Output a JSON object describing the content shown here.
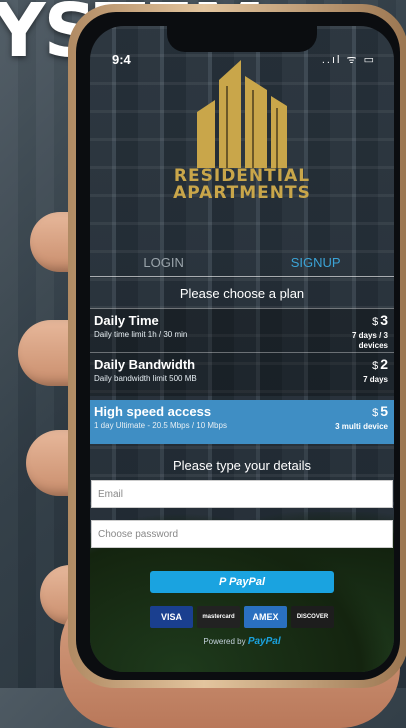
{
  "headline": "YSTEM",
  "status": {
    "time": "9:4",
    "icons": "..ıl ᯤ ▭"
  },
  "logo": {
    "line1": "RESIDENTIAL",
    "line2": "APARTMENTS",
    "color": "#c9a64a"
  },
  "tabs": [
    {
      "label": "LOGIN",
      "active": false
    },
    {
      "label": "SIGNUP",
      "active": true
    }
  ],
  "plans_title": "Please choose a plan",
  "plans": [
    {
      "name": "Daily Time",
      "desc": "Daily time limit 1h / 30 min",
      "currency": "$",
      "price": "3",
      "duration": "7 days / 3 devices"
    },
    {
      "name": "Daily Bandwidth",
      "desc": "Daily bandwidth limit 500 MB",
      "currency": "$",
      "price": "2",
      "duration": "7 days"
    },
    {
      "name": "High speed access",
      "desc": "1 day Ultimate - 20.5 Mbps / 10 Mbps",
      "currency": "$",
      "price": "5",
      "duration": "3 multi device",
      "selected": true
    }
  ],
  "details_title": "Please type your details",
  "form": {
    "email_placeholder": "Email",
    "password_placeholder": "Choose password"
  },
  "paypal": {
    "button_label": "P PayPal",
    "powered_by": "Powered by",
    "brand": "PayPal"
  },
  "cards": [
    {
      "name": "VISA",
      "color": "#1a3f8f"
    },
    {
      "name": "mastercard",
      "color": "#222222"
    },
    {
      "name": "AMEX",
      "color": "#2a70c0"
    },
    {
      "name": "DISCOVER",
      "color": "#1d1d1d"
    }
  ],
  "colors": {
    "accent": "#3ba3d6",
    "selected_plan": "#3f8ec4",
    "paypal": "#1aa3e0"
  }
}
